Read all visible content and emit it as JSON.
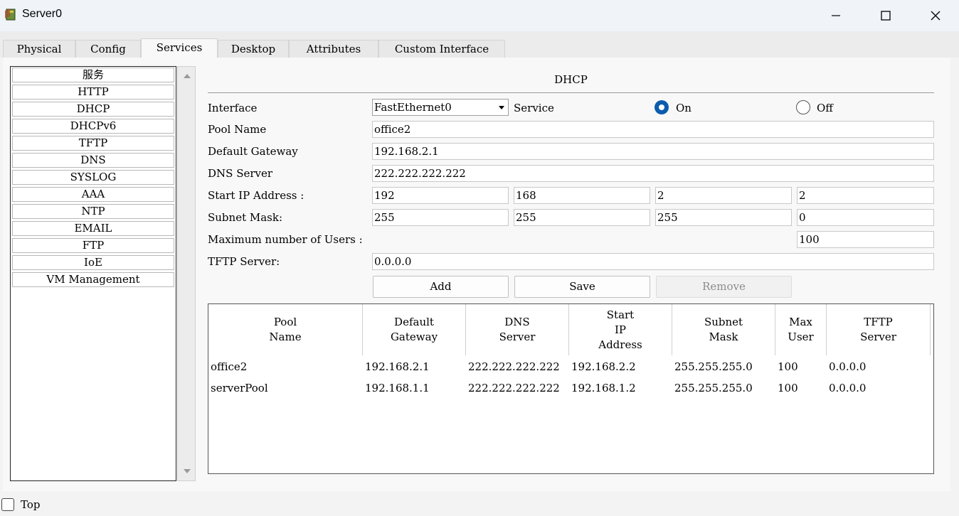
{
  "window": {
    "title": "Server0",
    "icon": "server-app-icon",
    "controls": [
      "minimize-icon",
      "maximize-icon",
      "close-icon"
    ]
  },
  "tabs": [
    {
      "label": "Physical",
      "active": false
    },
    {
      "label": "Config",
      "active": false
    },
    {
      "label": "Services",
      "active": true
    },
    {
      "label": "Desktop",
      "active": false
    },
    {
      "label": "Attributes",
      "active": false
    },
    {
      "label": "Custom Interface",
      "active": false
    }
  ],
  "services": {
    "items": [
      "服务",
      "HTTP",
      "DHCP",
      "DHCPv6",
      "TFTP",
      "DNS",
      "SYSLOG",
      "AAA",
      "NTP",
      "EMAIL",
      "FTP",
      "IoE",
      "VM Management"
    ]
  },
  "dhcp": {
    "title": "DHCP",
    "interface_label": "Interface",
    "interface_value": "FastEthernet0",
    "service_label": "Service",
    "on_label": "On",
    "off_label": "Off",
    "service_state": "On",
    "pool_name_label": "Pool Name",
    "pool_name_value": "office2",
    "gateway_label": "Default Gateway",
    "gateway_value": "192.168.2.1",
    "dns_label": "DNS Server",
    "dns_value": "222.222.222.222",
    "start_ip_label": "Start IP Address :",
    "start_ip": [
      "192",
      "168",
      "2",
      "2"
    ],
    "subnet_label": "Subnet Mask:",
    "subnet": [
      "255",
      "255",
      "255",
      "0"
    ],
    "max_users_label": "Maximum number of Users :",
    "max_users_value": "100",
    "tftp_label": "TFTP Server:",
    "tftp_value": "0.0.0.0",
    "add_label": "Add",
    "save_label": "Save",
    "remove_label": "Remove"
  },
  "pool_table": {
    "headers": [
      [
        "Pool",
        "Name"
      ],
      [
        "Default",
        "Gateway"
      ],
      [
        "DNS",
        "Server"
      ],
      [
        "Start",
        "IP",
        "Address"
      ],
      [
        "Subnet",
        "Mask"
      ],
      [
        "Max",
        "User"
      ],
      [
        "TFTP",
        "Server"
      ]
    ],
    "rows": [
      [
        "office2",
        "192.168.2.1",
        "222.222.222.222",
        "192.168.2.2",
        "255.255.255.0",
        "100",
        "0.0.0.0"
      ],
      [
        "serverPool",
        "192.168.1.1",
        "222.222.222.222",
        "192.168.1.2",
        "255.255.255.0",
        "100",
        "0.0.0.0"
      ]
    ]
  },
  "footer": {
    "top_label": "Top",
    "top_checked": false
  },
  "colors": {
    "radio_selected": "#0b5cad",
    "titlebar_bg": "#f0f4f9",
    "panel_bg": "#f8f8f8"
  }
}
